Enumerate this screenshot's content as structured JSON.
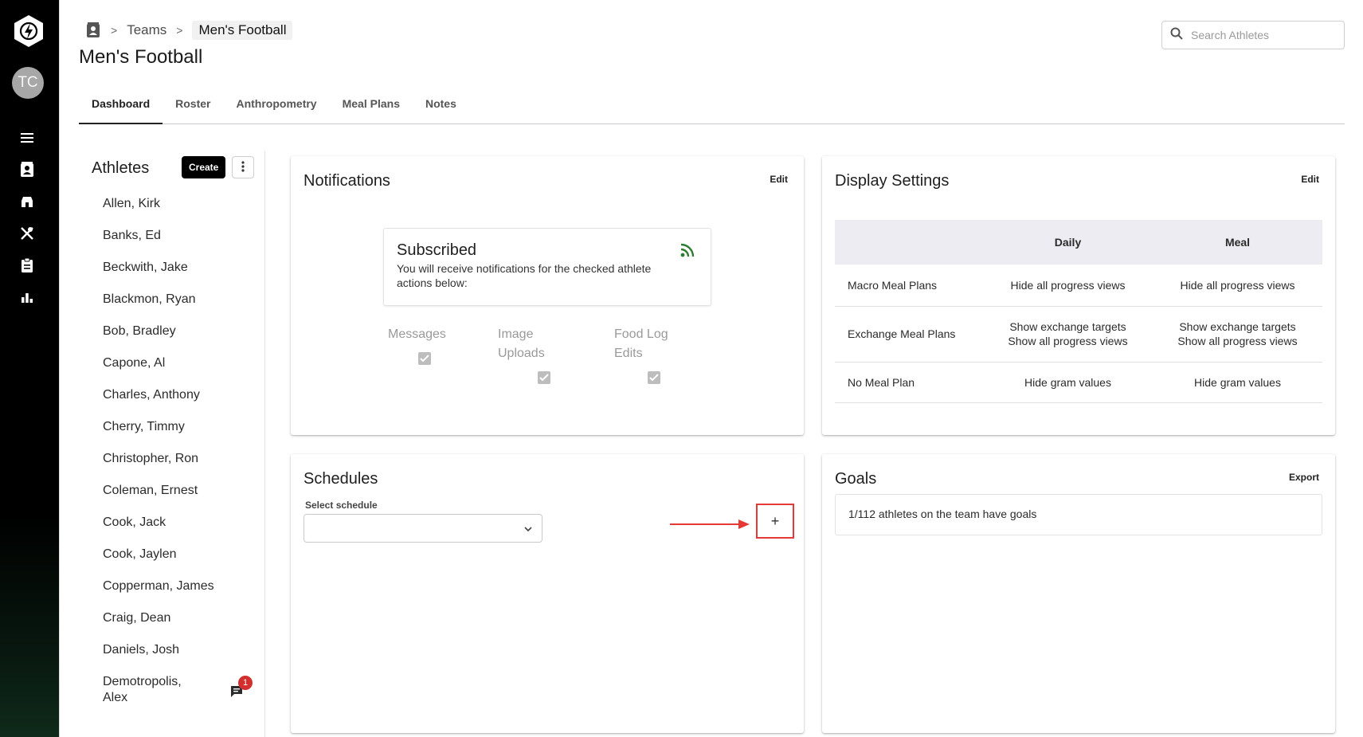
{
  "rail": {
    "avatar_initials": "TC",
    "icons": [
      "menu-icon",
      "contacts-icon",
      "store-icon",
      "utensils-icon",
      "clipboard-icon",
      "bar-chart-icon"
    ]
  },
  "breadcrumb": {
    "items": [
      "Teams",
      "Men's Football"
    ],
    "separator": ">"
  },
  "page_title": "Men's Football",
  "search": {
    "placeholder": "Search Athletes"
  },
  "tabs": [
    {
      "label": "Dashboard",
      "active": true
    },
    {
      "label": "Roster",
      "active": false
    },
    {
      "label": "Anthropometry",
      "active": false
    },
    {
      "label": "Meal Plans",
      "active": false
    },
    {
      "label": "Notes",
      "active": false
    }
  ],
  "athletes": {
    "title": "Athletes",
    "create_label": "Create",
    "list": [
      "Allen, Kirk",
      "Banks, Ed",
      "Beckwith, Jake",
      "Blackmon, Ryan",
      "Bob, Bradley",
      "Capone, Al",
      "Charles, Anthony",
      "Cherry, Timmy",
      "Christopher, Ron",
      "Coleman, Ernest",
      "Cook, Jack",
      "Cook, Jaylen",
      "Copperman, James",
      "Craig, Dean",
      "Daniels, Josh",
      "Demotropolis, Alex"
    ],
    "message_badge_count": "1"
  },
  "notifications": {
    "title": "Notifications",
    "edit_label": "Edit",
    "subscribed_title": "Subscribed",
    "subscribed_desc": "You will receive notifications for the checked athlete actions below:",
    "options": [
      {
        "label": "Messages",
        "checked": true
      },
      {
        "label": "Image Uploads",
        "checked": true
      },
      {
        "label": "Food Log Edits",
        "checked": true
      }
    ]
  },
  "display_settings": {
    "title": "Display Settings",
    "edit_label": "Edit",
    "columns": [
      "",
      "Daily",
      "Meal"
    ],
    "rows": [
      {
        "name": "Macro Meal Plans",
        "daily": [
          "Hide all progress views"
        ],
        "meal": [
          "Hide all progress views"
        ]
      },
      {
        "name": "Exchange Meal Plans",
        "daily": [
          "Show exchange targets",
          "Show all progress views"
        ],
        "meal": [
          "Show exchange targets",
          "Show all progress views"
        ]
      },
      {
        "name": "No Meal Plan",
        "daily": [
          "Hide gram values"
        ],
        "meal": [
          "Hide gram values"
        ]
      }
    ]
  },
  "schedules": {
    "title": "Schedules",
    "select_label": "Select schedule",
    "select_value": "",
    "add_label": "+"
  },
  "goals": {
    "title": "Goals",
    "export_label": "Export",
    "summary": "1/112 athletes on the team have goals"
  },
  "colors": {
    "rail_bg": "#000000",
    "accent_green": "#2e7d32",
    "highlight_red": "#e53935",
    "badge_red": "#d32f2f"
  }
}
